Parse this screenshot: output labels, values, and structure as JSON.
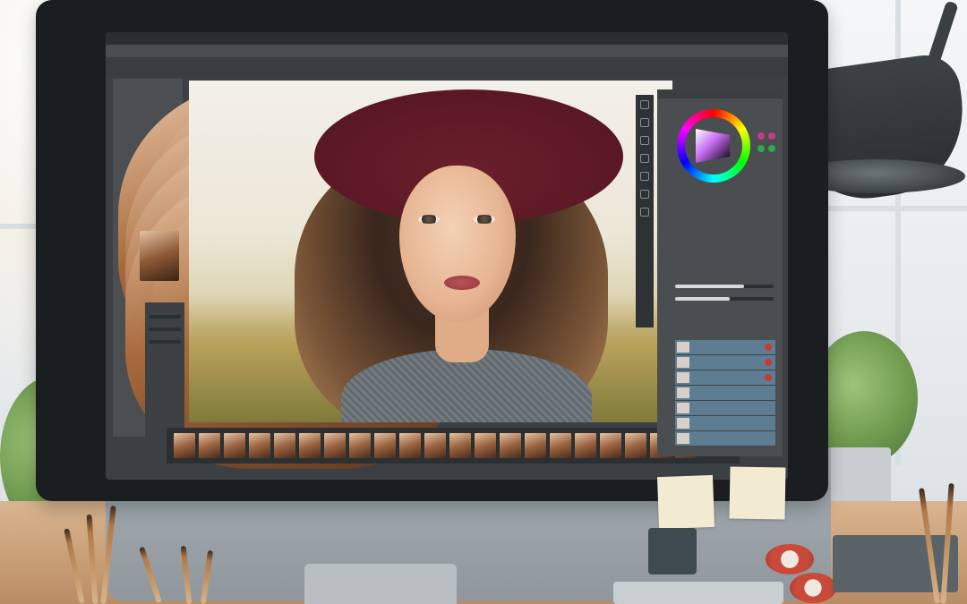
{
  "scene": {
    "description_tag": "photo-editing-workstation"
  },
  "app": {
    "menu": [
      "",
      "",
      "",
      "",
      "",
      ""
    ],
    "tabs": [
      "",
      "",
      ""
    ]
  },
  "colors": {
    "accent_wheel": [
      "#ff0000",
      "#ffff00",
      "#00ff00",
      "#00ffff",
      "#0000ff",
      "#ff00ff"
    ],
    "hat": "#6b1f2c",
    "panel": "#4a4e51",
    "layer_row": "#5f7d92",
    "sticky_note": "#f3ead2"
  },
  "icons": [
    "color-wheel-icon",
    "layer-visibility-icon",
    "brush-tool-icon",
    "move-tool-icon"
  ]
}
